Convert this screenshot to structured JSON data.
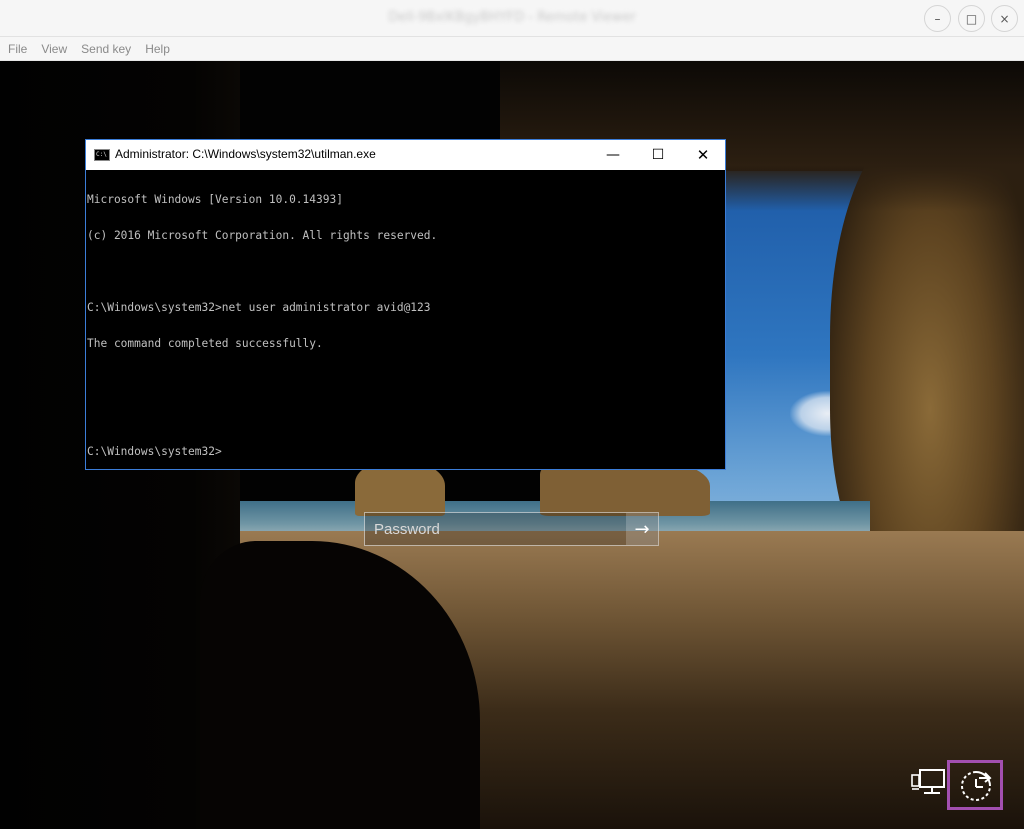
{
  "viewer": {
    "title": "Dell-9BxlKBgyBHYFD - Remote Viewer",
    "buttons": {
      "minimize": "–",
      "maximize": "□",
      "close": "×"
    },
    "menu": [
      "File",
      "View",
      "Send key",
      "Help"
    ]
  },
  "cmd": {
    "title": "Administrator: C:\\Windows\\system32\\utilman.exe",
    "icon_text": "C:\\",
    "buttons": {
      "minimize": "—",
      "maximize": "☐",
      "close": "✕"
    },
    "lines": [
      "Microsoft Windows [Version 10.0.14393]",
      "(c) 2016 Microsoft Corporation. All rights reserved.",
      "",
      "C:\\Windows\\system32>net user administrator avid@123",
      "The command completed successfully.",
      "",
      "",
      "C:\\Windows\\system32>"
    ]
  },
  "login": {
    "password_placeholder": "Password",
    "submit_arrow": "→"
  },
  "icons": {
    "network": "network-icon",
    "ease_of_access": "ease-of-access-icon",
    "highlight_color": "#a24fb0"
  },
  "colors": {
    "cmd_border": "#3b7dd8",
    "console_text": "#c0c0c0"
  }
}
